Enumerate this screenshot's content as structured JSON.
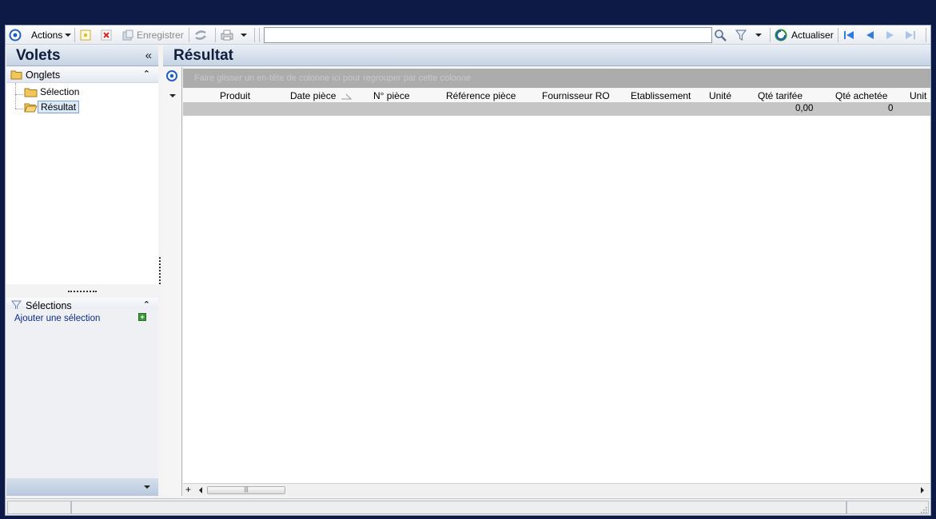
{
  "toolbar": {
    "actions_label": "Actions",
    "save_label": "Enregistrer",
    "search_value": "",
    "refresh_label": "Actualiser"
  },
  "left": {
    "title": "Volets",
    "tabs_section": "Onglets",
    "tree_items": [
      "Sélection",
      "Résultat"
    ],
    "selections_section": "Sélections",
    "add_selection": "Ajouter une sélection"
  },
  "right": {
    "title": "Résultat",
    "group_hint": "Faire glisser un en-tête de colonne ici pour regrouper par cette colonne",
    "columns": [
      "Produit",
      "Date pièce",
      "N° pièce",
      "Référence pièce",
      "Fournisseur RO",
      "Etablissement",
      "Unité",
      "Qté tarifée",
      "Qté achetée",
      "Unit"
    ],
    "totals": {
      "qte_tarifee": "0,00",
      "qte_achetee": "0"
    }
  },
  "colors": {
    "background": "#0c1a45",
    "header_gradient": "#c6d3e4",
    "group_bar": "#acacac",
    "total_row": "#c5c5c5"
  }
}
